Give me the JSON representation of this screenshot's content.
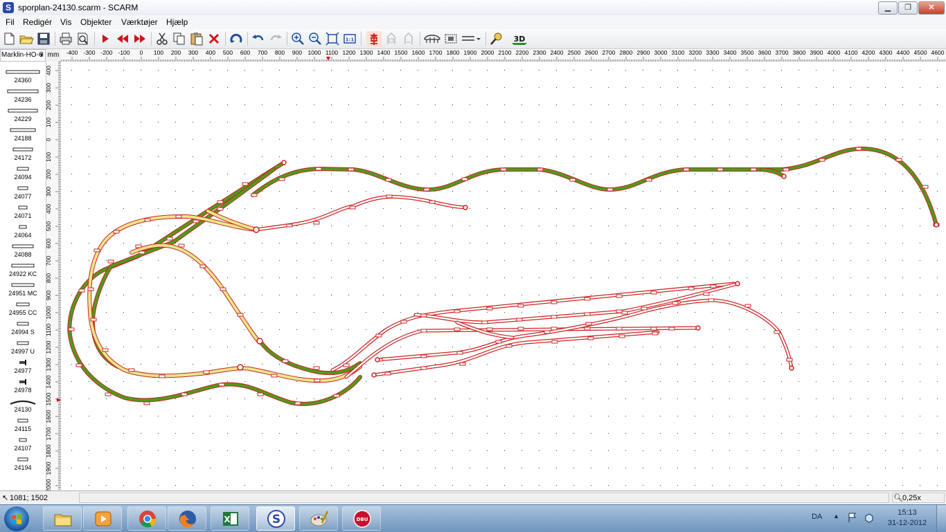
{
  "window": {
    "title": "sporplan-24130.scarm - SCARM",
    "app_icon_letter": "S",
    "buttons": {
      "minimize": "▁",
      "maximize": "❐",
      "close": "✕"
    }
  },
  "menu": [
    {
      "label": "Fil"
    },
    {
      "label": "Redigér"
    },
    {
      "label": "Vis"
    },
    {
      "label": "Objekter"
    },
    {
      "label": "Værktøjer"
    },
    {
      "label": "Hjælp"
    }
  ],
  "toolbar": {
    "items": [
      "new-icon",
      "open-icon",
      "save-icon",
      "print-icon",
      "print-preview-icon",
      "play-icon",
      "rewind-icon",
      "fast-forward-icon",
      "cut-icon",
      "copy-icon",
      "paste-icon",
      "delete-icon",
      "rotate-icon",
      "undo-icon",
      "redo-icon",
      "zoom-in-icon",
      "zoom-out-icon",
      "zoom-fit-icon",
      "zoom-1to1-icon",
      "track-tool-icon",
      "flex-track-icon",
      "turnout-tool-icon",
      "bridge-icon",
      "tunnel-icon",
      "level-icon",
      "measure-icon",
      "view-3d-icon"
    ],
    "zoom_1to1_label": "1:1",
    "view_3d_label": "3D"
  },
  "library": {
    "selected": "Marklin-HO-C"
  },
  "ruler": {
    "unit": "mm",
    "h_labels": [
      "-400",
      "-300",
      "-200",
      "-100",
      "0",
      "100",
      "200",
      "300",
      "400",
      "500",
      "600",
      "700",
      "800",
      "900",
      "1000",
      "1100",
      "1200",
      "1300",
      "1400",
      "1500",
      "1600",
      "1700",
      "1800",
      "1900",
      "2000",
      "2100",
      "2200",
      "2300",
      "2400",
      "2500",
      "2600",
      "2700",
      "2800",
      "2900",
      "3000",
      "3100",
      "3200",
      "3300",
      "3400",
      "3500",
      "3600",
      "3700",
      "3800",
      "3900",
      "4000",
      "4100",
      "4200",
      "4300",
      "4400",
      "4500",
      "4600"
    ],
    "v_labels": [
      "400",
      "300",
      "200",
      "100",
      "0",
      "100",
      "200",
      "300",
      "400",
      "500",
      "600",
      "700",
      "800",
      "900",
      "1000",
      "1100",
      "1200",
      "1300",
      "1400",
      "1500",
      "1600",
      "1700",
      "1800",
      "1900",
      "2000"
    ]
  },
  "palette": [
    {
      "label": "24360",
      "symbol": "straight"
    },
    {
      "label": "24236",
      "symbol": "straight"
    },
    {
      "label": "24229",
      "symbol": "straight"
    },
    {
      "label": "24188",
      "symbol": "straight"
    },
    {
      "label": "24172",
      "symbol": "straight"
    },
    {
      "label": "24094",
      "symbol": "straight"
    },
    {
      "label": "24077",
      "symbol": "straight"
    },
    {
      "label": "24071",
      "symbol": "straight"
    },
    {
      "label": "24064",
      "symbol": "straight"
    },
    {
      "label": "24088",
      "symbol": "straight"
    },
    {
      "label": "24922 KC",
      "symbol": "straight"
    },
    {
      "label": "24951 MC",
      "symbol": "straight"
    },
    {
      "label": "24955 CC",
      "symbol": "straight"
    },
    {
      "label": "24994 S",
      "symbol": "straight"
    },
    {
      "label": "24997 U",
      "symbol": "straight"
    },
    {
      "label": "24977",
      "symbol": "bumper"
    },
    {
      "label": "24978",
      "symbol": "bumper"
    },
    {
      "label": "24130",
      "symbol": "curve"
    },
    {
      "label": "24115",
      "symbol": "straight"
    },
    {
      "label": "24107",
      "symbol": "straight"
    },
    {
      "label": "24194",
      "symbol": "straight"
    }
  ],
  "status": {
    "coords": "1081; 1502",
    "zoom": "0,25x"
  },
  "taskbar": {
    "apps": [
      {
        "name": "explorer-icon",
        "active": false
      },
      {
        "name": "media-player-icon",
        "active": false
      },
      {
        "name": "chrome-icon",
        "active": false
      },
      {
        "name": "firefox-icon",
        "active": false
      },
      {
        "name": "excel-icon",
        "active": false
      },
      {
        "name": "scarm-icon",
        "active": true
      },
      {
        "name": "paint-icon",
        "active": false
      },
      {
        "name": "dbu-icon",
        "active": false
      }
    ],
    "dbu_text": "DBU",
    "scarm_letter": "S",
    "excel_letter": "X",
    "language": "DA",
    "tray_up": "▲",
    "time": "15:13",
    "date": "31-12-2012"
  },
  "colors": {
    "track_green": "#4f9a1c",
    "track_yellow": "#e9e68a",
    "track_outline_red": "#cc2222",
    "ruler_text": "#000000"
  }
}
